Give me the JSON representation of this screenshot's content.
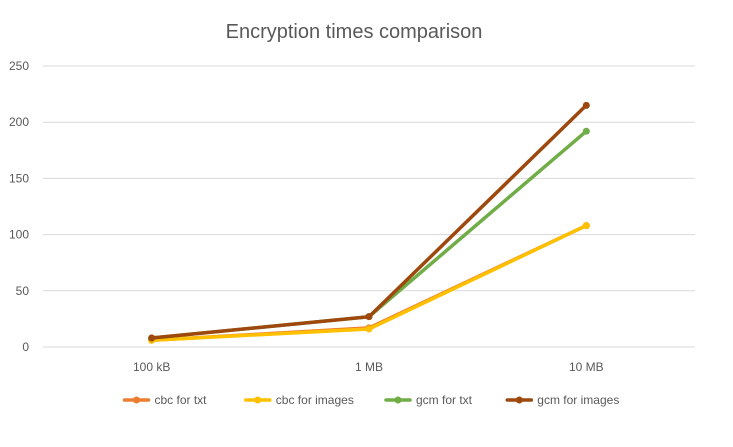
{
  "chart_data": {
    "type": "line",
    "title": "Encryption times comparison",
    "xlabel": "",
    "ylabel": "",
    "categories": [
      "100 kB",
      "1 MB",
      "10 MB"
    ],
    "ylim": [
      0,
      250
    ],
    "yticks": [
      0,
      50,
      100,
      150,
      200,
      250
    ],
    "grid": "horizontal",
    "legend_position": "bottom",
    "series": [
      {
        "name": "cbc for txt",
        "values": [
          6,
          17,
          108
        ],
        "color": "#ED7D31"
      },
      {
        "name": "cbc for images",
        "values": [
          6,
          16,
          108
        ],
        "color": "#FFC000"
      },
      {
        "name": "gcm for txt",
        "values": [
          8,
          27,
          192
        ],
        "color": "#70AD47"
      },
      {
        "name": "gcm for images",
        "values": [
          8,
          27,
          215
        ],
        "color": "#9E480E"
      }
    ]
  }
}
